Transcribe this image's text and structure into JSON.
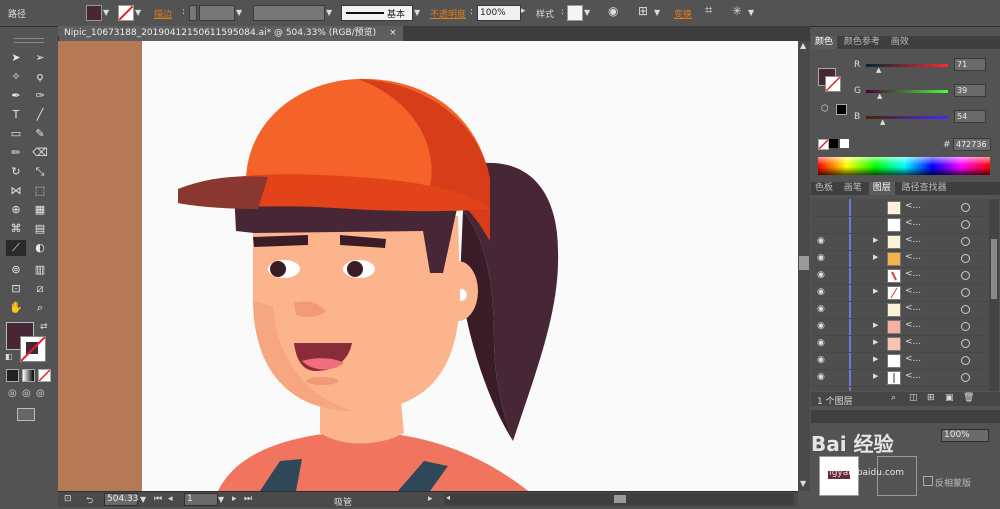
{
  "control_bar": {
    "object_type": "路径",
    "stroke_label": "描边",
    "stroke_profile": "基本",
    "opacity_label": "不透明度",
    "opacity_value": "100%",
    "style_label": "样式",
    "transform_label": "变换"
  },
  "document_tab": {
    "title": "Nipic_10673188_20190412150611595084.ai* @ 504.33% (RGB/预览)",
    "close": "×"
  },
  "status_bar": {
    "zoom": "504.33",
    "artboard": "1",
    "tool_name": "吸管"
  },
  "color_panel": {
    "tabs": [
      "颜色",
      "颜色参考",
      "画效"
    ],
    "r_label": "R",
    "r_value": "71",
    "g_label": "G",
    "g_value": "39",
    "b_label": "B",
    "b_value": "54",
    "hex_label": "#",
    "hex_value": "472736",
    "fill_color": "#472736"
  },
  "layers_panel": {
    "tabs": [
      "色板",
      "画笔",
      "图层",
      "路径查找器"
    ],
    "row_name": "<...",
    "footer": "1 个图层"
  },
  "bottom_panel": {
    "opacity_value": "100%",
    "make_mask_label": "反相蒙版"
  },
  "watermark": {
    "text": "Bai 经验",
    "url": "jingyan.baidu.com"
  }
}
